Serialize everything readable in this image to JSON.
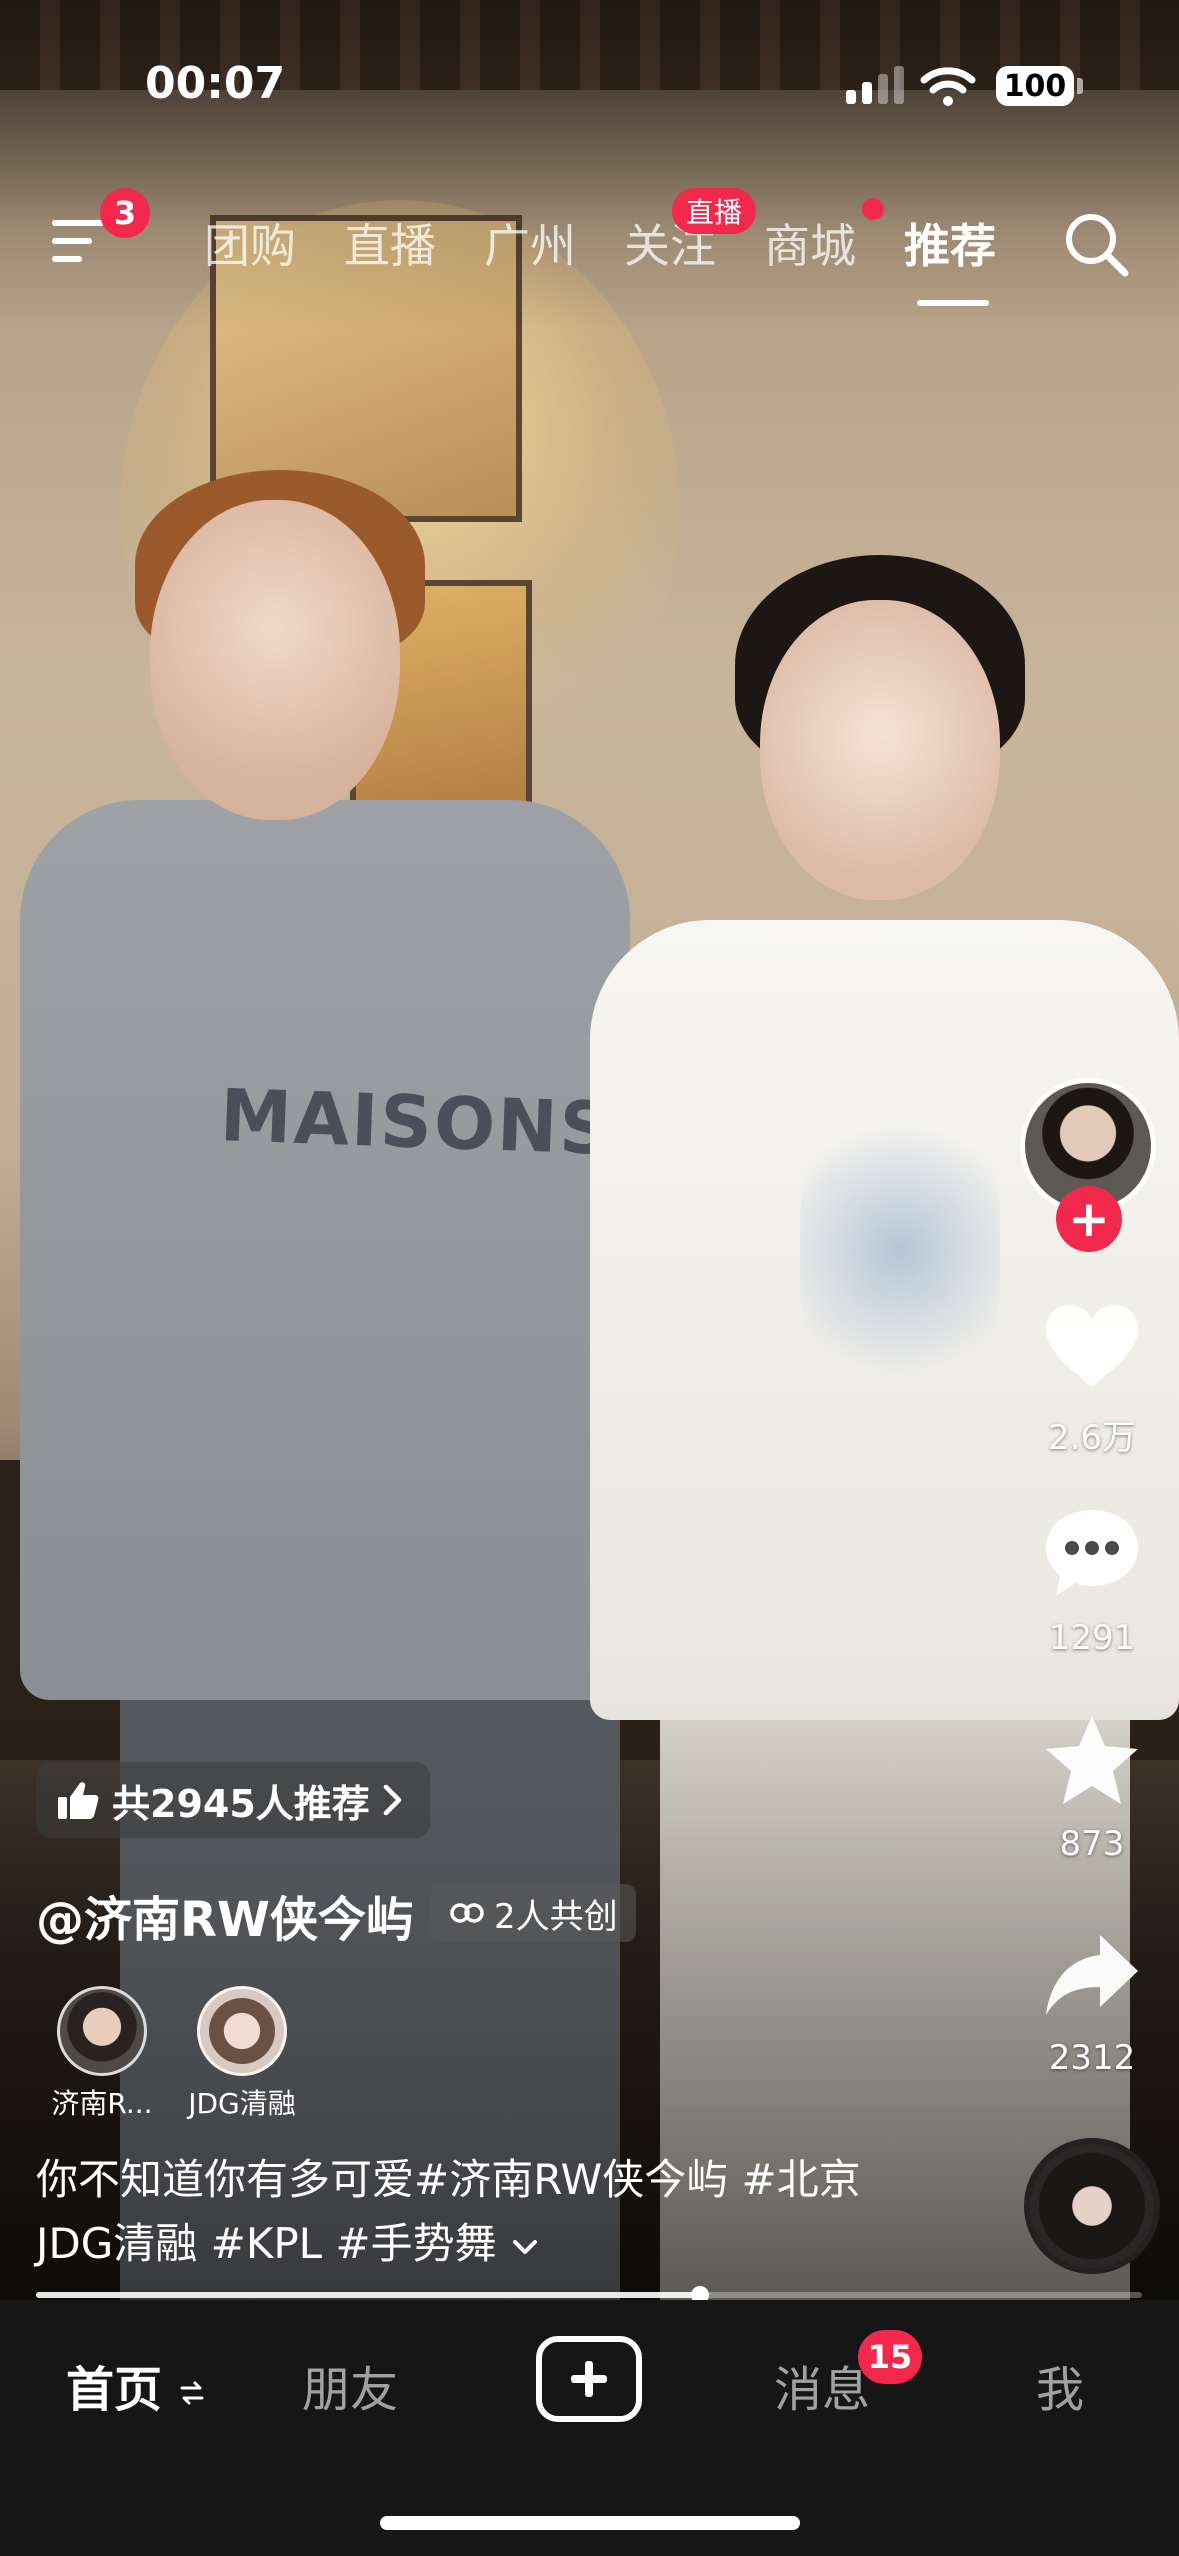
{
  "status": {
    "time": "00:07",
    "battery": "100"
  },
  "top_tabs": {
    "menu_badge": "3",
    "items": [
      {
        "label": "团购"
      },
      {
        "label": "直播"
      },
      {
        "label": "广州"
      },
      {
        "label": "关注"
      },
      {
        "label": "商城"
      },
      {
        "label": "推荐"
      }
    ],
    "active": "推荐",
    "live_badge": "直播"
  },
  "video": {
    "shirt_text": "MAISONS",
    "progress": 0.6
  },
  "right_rail": {
    "likes": "2.6万",
    "comments": "1291",
    "favorites": "873",
    "shares": "2312"
  },
  "info": {
    "recommend": "共2945人推荐",
    "author": "@济南RW侠今屿",
    "cocreate": "2人共创",
    "creators": [
      {
        "name": "济南R..."
      },
      {
        "name": "JDG清融"
      }
    ],
    "caption_line1": "你不知道你有多可爱#济南RW侠今屿 #北京",
    "caption_line2": "JDG清融 #KPL #手势舞",
    "expand_icon": "chevron-down-icon"
  },
  "tab_bar": {
    "home": "首页",
    "friends": "朋友",
    "messages": "消息",
    "messages_badge": "15",
    "me": "我"
  },
  "colors": {
    "accent": "#f2294d",
    "tabbar": "#161616"
  }
}
